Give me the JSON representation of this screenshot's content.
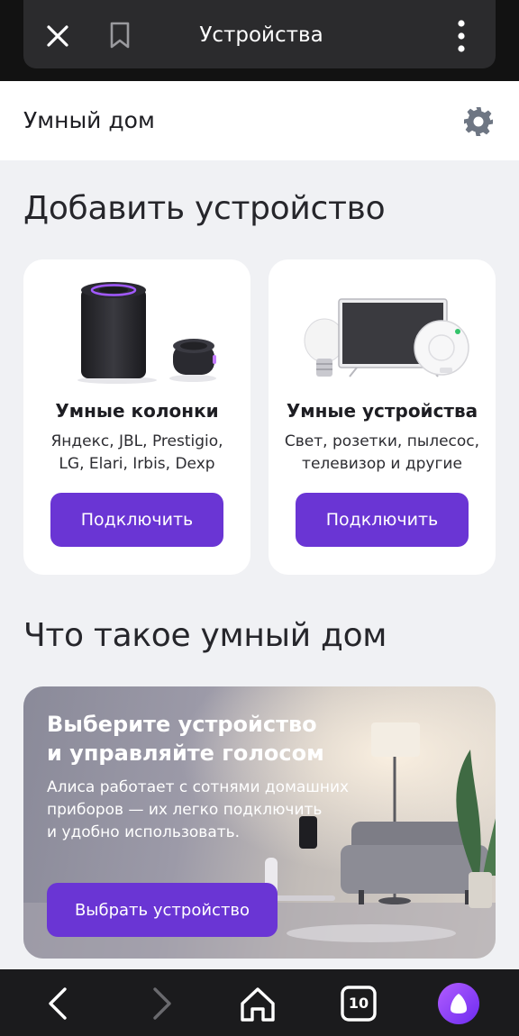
{
  "browser": {
    "title": "Устройства",
    "tabs_count": "10"
  },
  "header": {
    "title": "Умный дом"
  },
  "add_section": {
    "heading": "Добавить устройство",
    "cards": [
      {
        "title": "Умные колонки",
        "description": "Яндекс, JBL, Prestigio,\nLG, Elari, Irbis, Dexp",
        "button": "Подключить"
      },
      {
        "title": "Умные устройства",
        "description": "Свет, розетки, пылесос,\nтелевизор и другие",
        "button": "Подключить"
      }
    ]
  },
  "what_section": {
    "heading": "Что такое умный дом",
    "promo_title": "Выберите устройство\nи управляйте голосом",
    "promo_text": "Алиса работает с сотнями домашних\nприборов — их легко подключить\nи удобно использовать.",
    "promo_button": "Выбрать устройство"
  },
  "colors": {
    "accent": "#6a35d4",
    "background": "#f0f1f4",
    "card": "#ffffff",
    "bars": "#1b1b1d"
  },
  "icons": [
    "close-icon",
    "bookmark-icon",
    "more-vertical-icon",
    "gear-icon",
    "back-icon",
    "forward-icon",
    "home-icon",
    "tabs-icon",
    "alice-icon"
  ]
}
